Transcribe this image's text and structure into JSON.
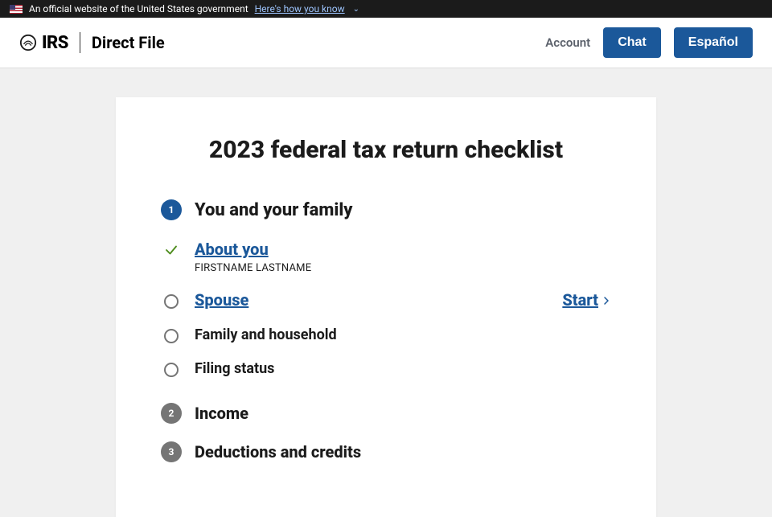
{
  "gov_banner": {
    "text": "An official website of the United States government",
    "link": "Here's how you know"
  },
  "header": {
    "irs": "IRS",
    "product": "Direct File",
    "account": "Account",
    "chat": "Chat",
    "espanol": "Español"
  },
  "page": {
    "title": "2023 federal tax return checklist"
  },
  "sections": [
    {
      "num": "1",
      "title": "You and your family",
      "active": true
    },
    {
      "num": "2",
      "title": "Income",
      "active": false
    },
    {
      "num": "3",
      "title": "Deductions and credits",
      "active": false
    }
  ],
  "items": [
    {
      "label": "About you",
      "sub": "FIRSTNAME LASTNAME",
      "status": "done",
      "link": true
    },
    {
      "label": "Spouse",
      "status": "open",
      "link": true,
      "action": "Start"
    },
    {
      "label": "Family and household",
      "status": "open",
      "link": false
    },
    {
      "label": "Filing status",
      "status": "open",
      "link": false
    }
  ]
}
